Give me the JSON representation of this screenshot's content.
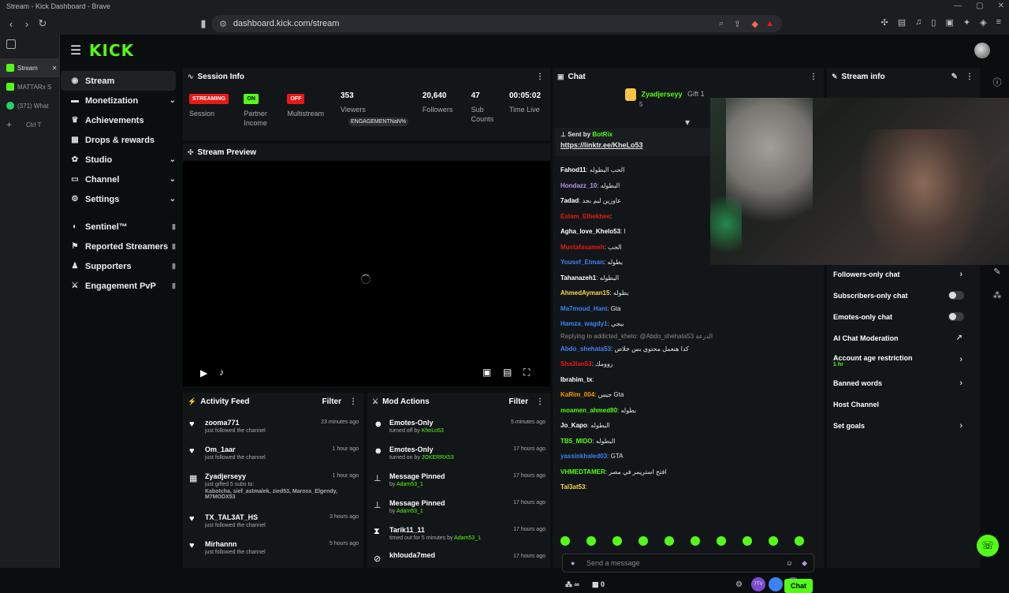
{
  "window": {
    "title": "Stream - Kick Dashboard - Brave"
  },
  "browser": {
    "url": "dashboard.kick.com/stream"
  },
  "tabs": [
    {
      "label": "Stream"
    },
    {
      "label": "MATTARx S"
    },
    {
      "label": "(371) What"
    },
    {
      "label": "Ctrl  T"
    }
  ],
  "app": {
    "logo": "KICK"
  },
  "sidebar": {
    "items": [
      {
        "label": "Stream"
      },
      {
        "label": "Monetization"
      },
      {
        "label": "Achievements"
      },
      {
        "label": "Drops & rewards"
      },
      {
        "label": "Studio"
      },
      {
        "label": "Channel"
      },
      {
        "label": "Settings"
      }
    ],
    "locked": [
      {
        "label": "Sentinel™"
      },
      {
        "label": "Reported Streamers"
      },
      {
        "label": "Supporters"
      },
      {
        "label": "Engagement PvP"
      }
    ]
  },
  "session": {
    "title": "Session Info",
    "streaming_badge": "STREAMING",
    "session_label": "Session",
    "on_badge": "ON",
    "partner_label": "Partner Income",
    "off_badge": "OFF",
    "multistream_label": "Multistream",
    "viewers_num": "353",
    "viewers_label": "Viewers",
    "engagement": "ENGAGEMENTNaN%",
    "followers_num": "20,640",
    "followers_label": "Followers",
    "subs_num": "47",
    "subs_label": "Sub Counts",
    "time_num": "00:05:02",
    "time_label": "Time Live"
  },
  "preview": {
    "title": "Stream Preview"
  },
  "activity": {
    "title": "Activity Feed",
    "filter": "Filter",
    "items": [
      {
        "name": "zooma771",
        "desc": "just followed the channel",
        "time": "23 minutes ago"
      },
      {
        "name": "Om_1aar",
        "desc": "just followed the channel",
        "time": "1 hour ago"
      },
      {
        "name": "Zyadjerseyy",
        "desc": "just gifted 5 subs to:",
        "extra": "Kabotcha, sief_astmalek, zied53, Maross_Elgendy, M7MODX53",
        "time": "1 hour ago"
      },
      {
        "name": "TX_TAL3AT_HS",
        "desc": "just followed the channel",
        "time": "3 hours ago"
      },
      {
        "name": "Mirhannn",
        "desc": "just followed the channel",
        "time": "5 hours ago"
      }
    ]
  },
  "mod": {
    "title": "Mod Actions",
    "filter": "Filter",
    "items": [
      {
        "name": "Emotes-Only",
        "desc": "turned off by",
        "by": "KheLo53",
        "time": "5 minutes ago"
      },
      {
        "name": "Emotes-Only",
        "desc": "turned on by",
        "by": "JOKERRX53",
        "time": "17 hours ago"
      },
      {
        "name": "Message Pinned",
        "desc": "by",
        "by": "Adam53_1",
        "time": "17 hours ago"
      },
      {
        "name": "Message Pinned",
        "desc": "by",
        "by": "Adam53_1",
        "time": "17 hours ago"
      },
      {
        "name": "Tarik11_11",
        "desc": "timed out for 5 minutes by",
        "by": "Adam53_1",
        "time": "17 hours ago"
      },
      {
        "name": "khlouda7med",
        "desc": "",
        "by": "",
        "time": "17 hours ago"
      }
    ]
  },
  "chat": {
    "title": "Chat",
    "gifter": "Zyadjerseyy",
    "gifter_count": "5",
    "gift_text": "Gift 1",
    "pinned_by": "Sent by",
    "pinned_bot": "BotRix",
    "pinned_link": "https://linktr.ee/KheLo53",
    "messages": [
      {
        "user": "Fahod11",
        "text": "الحب البطوله",
        "color": "#ffffff"
      },
      {
        "user": "Hondazz_10",
        "text": "البطوله",
        "color": "#b794f4"
      },
      {
        "user": "7adad",
        "text": "عاوزين ليم بجد",
        "color": "#ffffff"
      },
      {
        "user": "Eslam_Elbekhee",
        "text": "",
        "color": "#e91916"
      },
      {
        "user": "Agha_love_Khelo53",
        "text": "ا",
        "color": "#ffffff"
      },
      {
        "user": "Mustafasameh",
        "text": "الحب",
        "color": "#e91916"
      },
      {
        "user": "Yousef_Etman",
        "text": "بطوله",
        "color": "#3b82f6"
      },
      {
        "user": "Tahanazeh1",
        "text": "البطوله",
        "color": "#ffffff"
      },
      {
        "user": "AhmedAyman15",
        "text": "بطوله",
        "color": "#ffd54f"
      },
      {
        "user": "Ma7moud_Hani",
        "text": "Gta",
        "color": "#3b82f6"
      },
      {
        "user": "Hamza_wagdy1",
        "text": "بيجي",
        "color": "#3b82f6"
      },
      {
        "user": "Abdo_shehata53",
        "text": "كدا هنعمل محتوي بس خلاص",
        "color": "#3b82f6",
        "reply": "Replying to addicted_khelo: @Abdo_shehata53 الدرعة"
      },
      {
        "user": "Sha3lan53",
        "text": "روومك",
        "color": "#e91916"
      },
      {
        "user": "Ibrahim_tx",
        "text": "",
        "color": "#ffffff"
      },
      {
        "user": "KaRim_004",
        "text": "جيس Gta",
        "color": "#ff9800"
      },
      {
        "user": "moamen_ahmed80",
        "text": "بطوله",
        "color": "#53fc18"
      },
      {
        "user": "Jo_Kapo",
        "text": "البطوله",
        "color": "#ffffff"
      },
      {
        "user": "TB5_MIDO",
        "text": "البطوله",
        "color": "#53fc18"
      },
      {
        "user": "yassinkhaled03",
        "text": "GTA",
        "color": "#3b82f6"
      },
      {
        "user": "VHMEDTAMER",
        "text": "افتح استريمر في مصر",
        "color": "#53fc18"
      },
      {
        "user": "Tal3at53",
        "text": "",
        "color": "#ffd54f"
      }
    ],
    "input_placeholder": "Send a message",
    "points": "∞",
    "gift_count": "0",
    "send_label": "Chat"
  },
  "stream_info": {
    "title": "Stream info",
    "rows": [
      {
        "label": "Followers-only chat"
      },
      {
        "label": "Subscribers-only chat"
      },
      {
        "label": "Emotes-only chat"
      },
      {
        "label": "AI Chat Moderation"
      },
      {
        "label": "Account age restriction",
        "sub": "1 hr"
      },
      {
        "label": "Banned words"
      },
      {
        "label": "Host Channel"
      },
      {
        "label": "Set goals"
      }
    ]
  }
}
